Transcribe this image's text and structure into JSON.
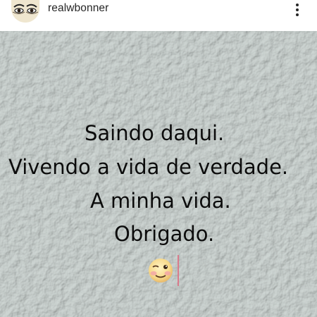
{
  "post": {
    "username": "realwbonner",
    "avatar_icon": "eyes-avatar-icon",
    "more_icon": "more-vertical-icon"
  },
  "image": {
    "lines": [
      "Saindo daqui.",
      "Vivendo a vida de verdade.",
      "A minha vida.",
      "Obrigado."
    ],
    "emoji_icon": "winking-face-icon",
    "background_color": "#bcc3c1",
    "text_color": "#0c0c0c"
  }
}
